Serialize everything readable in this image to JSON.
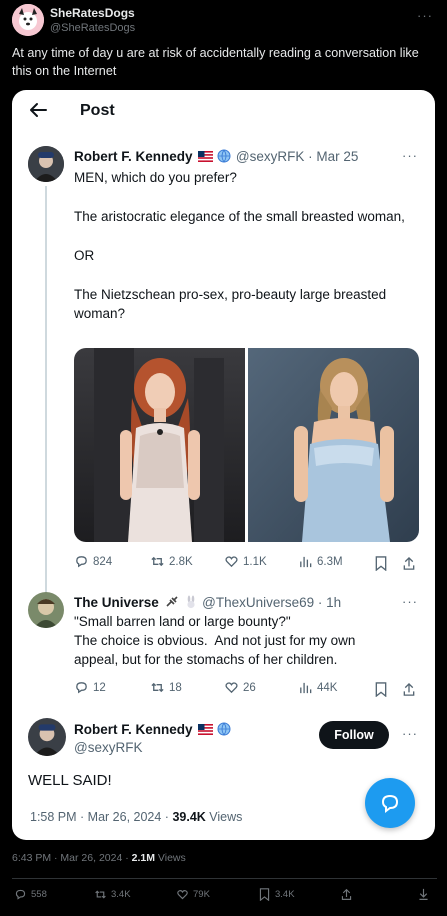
{
  "outer_post": {
    "display_name": "SheRatesDogs",
    "handle": "@SheRatesDogs",
    "text": "At any time of day u are at risk of accidentally reading a conversation like this on the Internet",
    "time": "6:43 PM · Mar 26, 2024 ·",
    "views_count": "2.1M",
    "views_label": "Views",
    "stats": {
      "replies": "558",
      "reposts": "3.4K",
      "likes": "79K",
      "bookmarks": "3.4K"
    }
  },
  "screenshot": {
    "title": "Post",
    "tweet1": {
      "name": "Robert F. Kennedy",
      "handle_date": "@sexyRFK · Mar 25",
      "line1": "MEN, which do you prefer?",
      "line2": "The aristocratic elegance of the small breasted woman,",
      "line3": "OR",
      "line4": "The Nietzschean pro-sex, pro-beauty large breasted woman?",
      "stats": {
        "replies": "824",
        "reposts": "2.8K",
        "likes": "1.1K",
        "views": "6.3M"
      }
    },
    "tweet2": {
      "name": "The Universe",
      "handle_date": "@ThexUniverse69 · 1h",
      "line1": "\"Small barren land or large bounty?\"",
      "line2": "The choice is obvious.  And not just for my own appeal, but for the stomachs of her children.",
      "stats": {
        "replies": "12",
        "reposts": "18",
        "likes": "26",
        "views": "44K"
      }
    },
    "tweet3": {
      "name": "Robert F. Kennedy",
      "handle": "@sexyRFK",
      "follow": "Follow",
      "text": "WELL SAID!",
      "time": "1:58 PM · Mar 26, 2024 ·",
      "views_count": "39.4K",
      "views_label": "Views"
    }
  },
  "colors": {
    "accent": "#1d9bf0",
    "background": "#000000",
    "card": "#ffffff"
  }
}
